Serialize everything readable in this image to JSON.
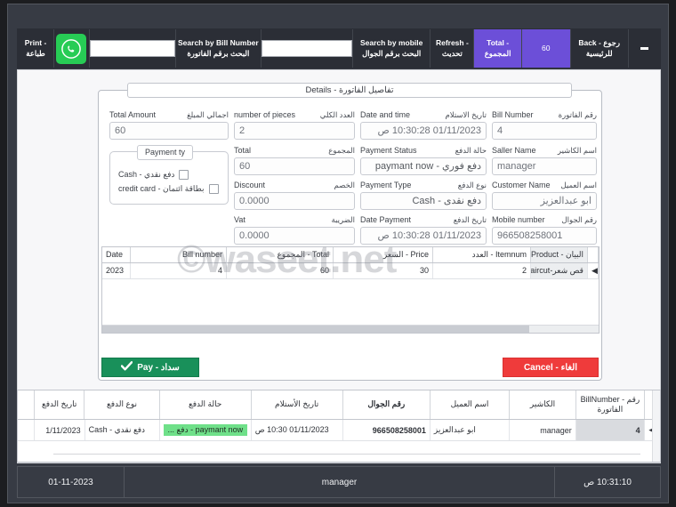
{
  "toolbar": {
    "print": {
      "en": "Print -",
      "ar": "طباعة"
    },
    "whatsapp_icon": "whatsapp-icon",
    "bill_search_value": "",
    "bill_search_placeholder": "",
    "search_by_bill": {
      "en": "Search by Bill Number",
      "ar": "البحث برقم الفاتورة"
    },
    "mobile_search_value": "",
    "mobile_search_placeholder": "",
    "search_by_mobile": {
      "en": "Search by mobile",
      "ar": "البحث برقم الجوال"
    },
    "refresh": {
      "en": "Refresh -",
      "ar": "تحديث"
    },
    "total": {
      "en": "Total -",
      "ar": "المجموع"
    },
    "total_value": "60",
    "back": {
      "en": "Back  -  رجوع",
      "ar": "للرئيسية"
    },
    "minimize_icon": "minimize-icon",
    "accent_purple": "#6c4fd8",
    "bar_dark": "#2b2e36"
  },
  "dialog": {
    "title": "تفاصيل الفاتورة - Details",
    "fields": {
      "total_amount": {
        "en": "Total Amount",
        "ar": "اجمالي المبلغ",
        "value": "60"
      },
      "number_of_pieces": {
        "en": "number of pieces",
        "ar": "العدد الكلي",
        "value": "2"
      },
      "date_and_time": {
        "en": "Date and time",
        "ar": "تاريخ الاستلام",
        "value": "01/11/2023 10:30:28 ص"
      },
      "bill_number": {
        "en": "Bill Number",
        "ar": "رقم الفاتورة",
        "value": "4"
      },
      "total": {
        "en": "Total",
        "ar": "المجموع",
        "value": "60"
      },
      "payment_status": {
        "en": "Payment Status",
        "ar": "حالة الدفع",
        "value": "دفع فوري - paymant now"
      },
      "seller_name": {
        "en": "Saller Name",
        "ar": "اسم الكاشير",
        "value": "manager"
      },
      "discount": {
        "en": "Discount",
        "ar": "الخصم",
        "value": "0.0000"
      },
      "payment_type": {
        "en": "Payment Type",
        "ar": "نوع الدفع",
        "value": "دفع نقدى - Cash"
      },
      "customer_name": {
        "en": "Customer Name",
        "ar": "اسم العميل",
        "value": "ابو عبدالعزيز"
      },
      "vat": {
        "en": "Vat",
        "ar": "الضريبة",
        "value": "0.0000"
      },
      "date_payment": {
        "en": "Date Payment",
        "ar": "تاريخ الدفع",
        "value": "01/11/2023 10:30:28 ص"
      },
      "mobile_number": {
        "en": "Mobile number",
        "ar": "رقم الجوال",
        "value": "966508258001"
      }
    },
    "payment_group": {
      "title": "Payment ty",
      "options": [
        {
          "label": "دفع نقدي  - Cash",
          "checked": false
        },
        {
          "label": "بطاقة ائتمان - credit card",
          "checked": false
        }
      ]
    },
    "items_grid": {
      "headers": [
        "Date",
        "Bill number",
        "المجموع - Total",
        "السعر - Price",
        "العدد - Itemnum",
        "البيان - Product"
      ],
      "rows": [
        [
          "2023",
          "4",
          "60",
          "30",
          "2",
          "قص شعر-Haircut-تخفيف ..."
        ]
      ],
      "row_selector": "◀"
    },
    "pay_button": {
      "label": "سداد - Pay",
      "icon": "check-icon",
      "color": "#19905a"
    },
    "cancel_button": {
      "label": "الغاء - Cancel",
      "color": "#ef3b3b"
    }
  },
  "watermark": "©waseet.net",
  "bills_grid": {
    "headers": [
      "",
      "رقم - BillNumber الفاتورة",
      "الكاشير",
      "اسم العميل",
      "رقم الجوال",
      "تاريخ الأستلام",
      "حالة الدفع",
      "نوع الدفع",
      "تاريخ الدفع"
    ],
    "rows": [
      {
        "selector": "◀",
        "bill_number": "4",
        "cashier": "manager",
        "customer": "ابو عبدالعزيز",
        "mobile": "966508258001",
        "receive_date": "01/11/2023 10:30 ص",
        "status": "paymant now - دفع ...",
        "status_color": "#6fe089",
        "pay_type": "دفع نقدي  - Cash",
        "pay_date": "1/11/2023"
      }
    ]
  },
  "statusbar": {
    "date": "01-11-2023",
    "user": "manager",
    "time": "10:31:10 ص"
  }
}
